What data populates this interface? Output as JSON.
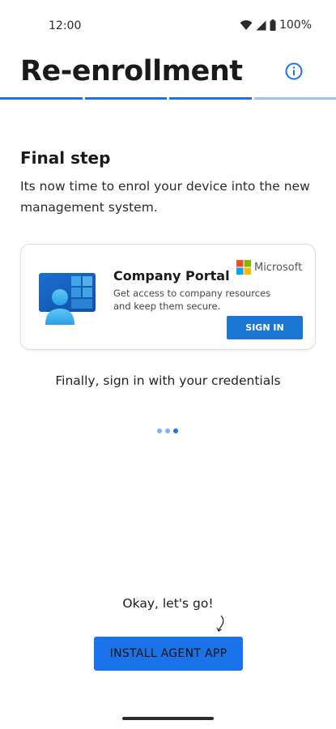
{
  "status_bar": {
    "time": "12:00",
    "battery": "100%",
    "icons": [
      "wifi-icon",
      "cellular-signal-icon",
      "battery-icon"
    ]
  },
  "header": {
    "title": "Re-enrollment",
    "info_icon": "info-icon"
  },
  "progress": {
    "total_steps": 4,
    "completed_steps": 3
  },
  "step": {
    "heading": "Final step",
    "description": "Its now time to enrol your device into the new management system."
  },
  "card": {
    "title": "Company Portal",
    "description": "Get access to company resources and keep them secure.",
    "brand": "Microsoft",
    "button_label": "SIGN IN"
  },
  "instruction": "Finally, sign in with your credentials",
  "footer": {
    "encourage": "Okay, let's go!",
    "install_label": "INSTALL AGENT APP"
  },
  "colors": {
    "accent": "#1a73e8",
    "progress_pending": "#9ec3ee",
    "card_button": "#1976d2"
  }
}
